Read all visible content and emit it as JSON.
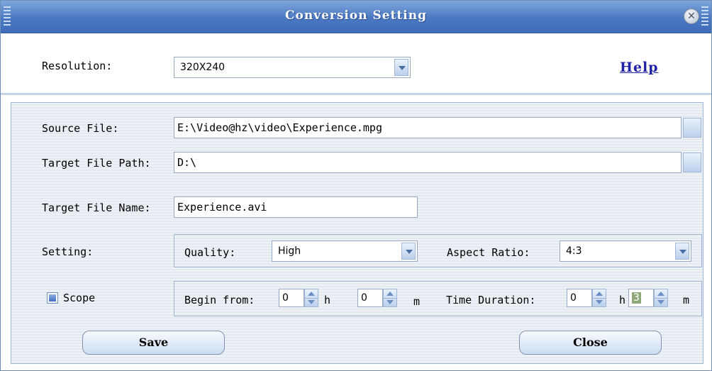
{
  "window": {
    "title": "Conversion Setting"
  },
  "resolution": {
    "label": "Resolution:",
    "value": "320X240"
  },
  "help_link": "Help",
  "source_file": {
    "label": "Source File:",
    "value": "E:\\Video@hz\\video\\Experience.mpg"
  },
  "target_path": {
    "label": "Target File Path:",
    "value": "D:\\"
  },
  "target_name": {
    "label": "Target File Name:",
    "value": "Experience.avi"
  },
  "setting": {
    "label": "Setting:",
    "quality_label": "Quality:",
    "quality_value": "High",
    "aspect_label": "Aspect Ratio:",
    "aspect_value": "4:3"
  },
  "scope": {
    "label": "Scope",
    "begin_label": "Begin from:",
    "begin_h": "0",
    "h_unit": "h",
    "begin_m": "0",
    "m_unit": "m",
    "duration_label": "Time Duration:",
    "duration_h": "0",
    "duration_h_unit": "h",
    "duration_m": "3",
    "duration_m_unit": "m"
  },
  "buttons": {
    "save": "Save",
    "close": "Close"
  },
  "colors": {
    "titlebar": "#4a78c2",
    "help_link": "#1f22a5",
    "accent_highlight": "#8fa87a"
  },
  "icons": {
    "close": "close-icon",
    "dropdown": "chevron-down-icon",
    "spin": "spin-arrows-icon"
  }
}
